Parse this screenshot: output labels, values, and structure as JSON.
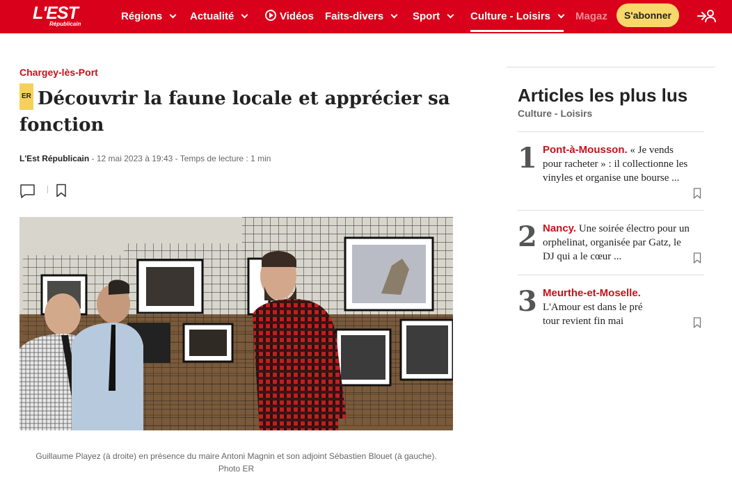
{
  "header": {
    "logo_main": "L'EST",
    "logo_sub": "Républicain",
    "nav": [
      {
        "label": "Régions"
      },
      {
        "label": "Actualité"
      },
      {
        "label": "Vidéos"
      },
      {
        "label": "Faits-divers"
      },
      {
        "label": "Sport"
      },
      {
        "label": "Culture - Loisirs"
      }
    ],
    "nav_fade": "Magaz",
    "subscribe_label": "S'abonner",
    "brand_color": "#d9001b",
    "accent_color": "#f8d86a"
  },
  "article": {
    "locality": "Chargey-lès-Port",
    "badge": "ER",
    "title": "Découvrir la faune locale et apprécier sa fonction",
    "author": "L'Est Républicain",
    "meta": " - 12 mai 2023 à 19:43 - Temps de lecture : 1 min",
    "caption_line1": "Guillaume Playez (à droite) en présence du maire Antoni Magnin et son adjoint Sébastien Blouet (à gauche).",
    "caption_line2": "Photo ER"
  },
  "sidebar": {
    "title": "Articles les plus lus",
    "subtitle": "Culture - Loisirs",
    "items": [
      {
        "rank": "1",
        "place": "Pont-à-Mousson.",
        "text": " « Je vends pour racheter » : il collectionne les vinyles et organise une bourse ..."
      },
      {
        "rank": "2",
        "place": "Nancy.",
        "text": " Une soirée électro pour un orphelinat, organisée par Gatz, le DJ qui a le cœur ..."
      },
      {
        "rank": "3",
        "place": "Meurthe-et-Moselle.",
        "text": " L'Amour est dans le pré tour revient fin mai"
      }
    ]
  }
}
